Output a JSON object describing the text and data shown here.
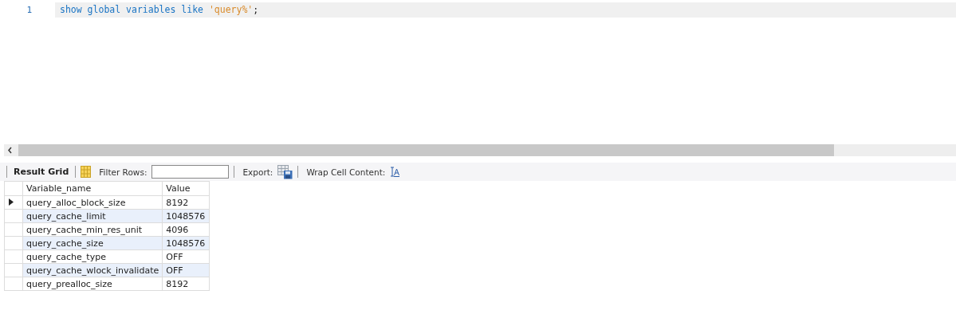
{
  "editor": {
    "lines": [
      {
        "number": "1",
        "tokens": [
          {
            "text": "show global variables like",
            "kind": "keyword"
          },
          {
            "text": "'query%'",
            "kind": "string"
          },
          {
            "text": ";",
            "kind": "plain"
          }
        ]
      }
    ]
  },
  "toolbar": {
    "result_grid": "Result Grid",
    "filter_label": "Filter Rows:",
    "export_label": "Export:",
    "wrap_label": "Wrap Cell Content:"
  },
  "table": {
    "columns": [
      "Variable_name",
      "Value"
    ],
    "rows": [
      {
        "cells": [
          "query_alloc_block_size",
          "8192"
        ],
        "selected": true
      },
      {
        "cells": [
          "query_cache_limit",
          "1048576"
        ],
        "selected": false
      },
      {
        "cells": [
          "query_cache_min_res_unit",
          "4096"
        ],
        "selected": false
      },
      {
        "cells": [
          "query_cache_size",
          "1048576"
        ],
        "selected": false
      },
      {
        "cells": [
          "query_cache_type",
          "OFF"
        ],
        "selected": false
      },
      {
        "cells": [
          "query_cache_wlock_invalidate",
          "OFF"
        ],
        "selected": false
      },
      {
        "cells": [
          "query_prealloc_size",
          "8192"
        ],
        "selected": false
      }
    ]
  }
}
